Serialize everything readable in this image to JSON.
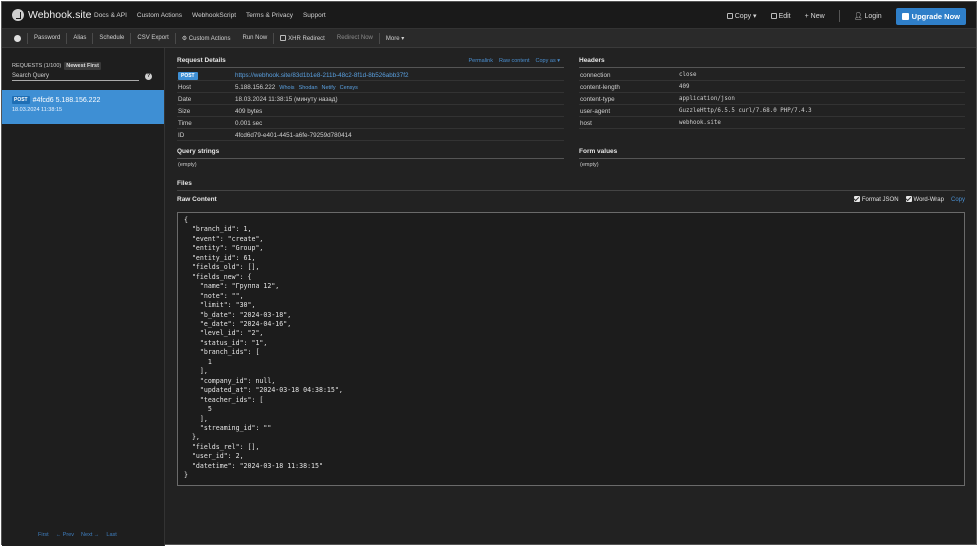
{
  "navbar": {
    "brand": "Webhook.site",
    "links": [
      "Docs & API",
      "Custom Actions",
      "WebhookScript",
      "Terms & Privacy",
      "Support"
    ],
    "copy": "Copy ▾",
    "edit": "Edit",
    "new": "+ New",
    "login": "Login",
    "upgrade": "Upgrade Now"
  },
  "toolbar": {
    "items": [
      "Password",
      "Alias",
      "Schedule",
      "CSV Export"
    ],
    "custom_actions": "Custom Actions",
    "run_now": "Run Now",
    "xhr_redirect": "XHR Redirect",
    "redirect_now": "Redirect Now",
    "more": "More ▾"
  },
  "sidebar": {
    "requests_label": "REQUESTS (1/100)",
    "newest_first": "Newest First",
    "search_placeholder": "Search Query",
    "request": {
      "method": "POST",
      "title": "#4fcd6 5.188.156.222",
      "date": "18.03.2024 11:38:15"
    },
    "pager": [
      "First",
      "← Prev",
      "Next →",
      "Last"
    ]
  },
  "request_details": {
    "title": "Request Details",
    "links": [
      "Permalink",
      "Raw content",
      "Copy as ▾"
    ],
    "method": "POST",
    "url": "https://webhook.site/83d1b1e8-211b-48c2-8f1d-8b526abb37f2",
    "rows": [
      {
        "key": "Host",
        "value": "5.188.156.222",
        "extra": [
          "Whois",
          "Shodan",
          "Netify",
          "Censys"
        ]
      },
      {
        "key": "Date",
        "value": "18.03.2024 11:38:15 (минуту назад)"
      },
      {
        "key": "Size",
        "value": "409 bytes"
      },
      {
        "key": "Time",
        "value": "0.001 sec"
      },
      {
        "key": "ID",
        "value": "4fcd6d79-e401-4451-a6fe-79259d780414"
      }
    ]
  },
  "headers": {
    "title": "Headers",
    "rows": [
      {
        "key": "connection",
        "value": "close"
      },
      {
        "key": "content-length",
        "value": "409"
      },
      {
        "key": "content-type",
        "value": "application/json"
      },
      {
        "key": "user-agent",
        "value": "GuzzleHttp/6.5.5 curl/7.68.0 PHP/7.4.3"
      },
      {
        "key": "host",
        "value": "webhook.site"
      }
    ]
  },
  "query_strings": {
    "title": "Query strings",
    "empty": "(empty)"
  },
  "form_values": {
    "title": "Form values",
    "empty": "(empty)"
  },
  "files": {
    "title": "Files"
  },
  "raw_content": {
    "title": "Raw Content",
    "format_json": "Format JSON",
    "word_wrap": "Word-Wrap",
    "copy": "Copy",
    "body": "{\n  \"branch_id\": 1,\n  \"event\": \"create\",\n  \"entity\": \"Group\",\n  \"entity_id\": 61,\n  \"fields_old\": [],\n  \"fields_new\": {\n    \"name\": \"Группа 12\",\n    \"note\": \"\",\n    \"limit\": \"30\",\n    \"b_date\": \"2024-03-18\",\n    \"e_date\": \"2024-04-16\",\n    \"level_id\": \"2\",\n    \"status_id\": \"1\",\n    \"branch_ids\": [\n      1\n    ],\n    \"company_id\": null,\n    \"updated_at\": \"2024-03-18 04:38:15\",\n    \"teacher_ids\": [\n      5\n    ],\n    \"streaming_id\": \"\"\n  },\n  \"fields_rel\": [],\n  \"user_id\": 2,\n  \"datetime\": \"2024-03-18 11:38:15\"\n}"
  }
}
